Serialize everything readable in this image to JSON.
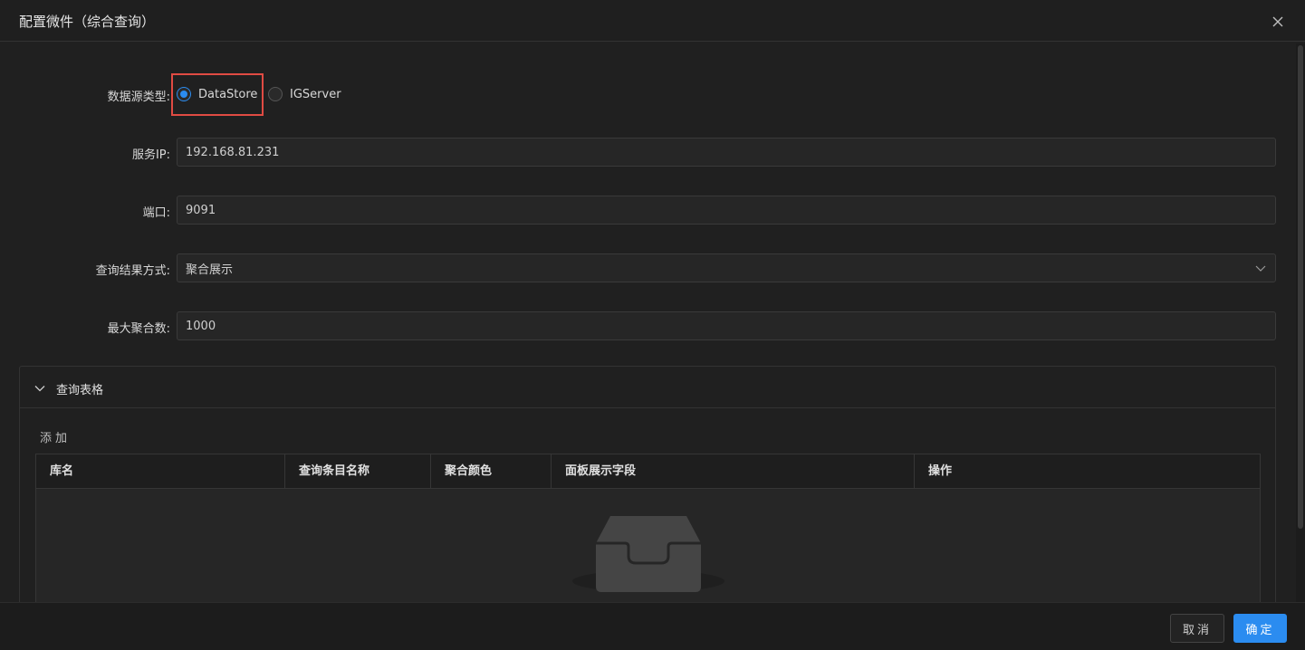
{
  "dialog": {
    "title": "配置微件（综合查询）"
  },
  "form": {
    "datasource_label": "数据源类型:",
    "datasource_options": [
      {
        "label": "DataStore",
        "checked": true
      },
      {
        "label": "IGServer",
        "checked": false
      }
    ],
    "ip_label": "服务IP:",
    "ip_value": "192.168.81.231",
    "port_label": "端口:",
    "port_value": "9091",
    "mode_label": "查询结果方式:",
    "mode_value": "聚合展示",
    "max_label": "最大聚合数:",
    "max_value": "1000"
  },
  "panel": {
    "title": "查询表格",
    "add_label": "添加",
    "columns": [
      "库名",
      "查询条目名称",
      "聚合颜色",
      "面板展示字段",
      "操作"
    ]
  },
  "footer": {
    "cancel_label": "取消",
    "ok_label": "确定"
  },
  "colors": {
    "accent": "#2b8cf0",
    "highlight": "#e04b43"
  },
  "icons": [
    "close-icon",
    "chevron-down-icon",
    "empty-inbox-icon"
  ]
}
